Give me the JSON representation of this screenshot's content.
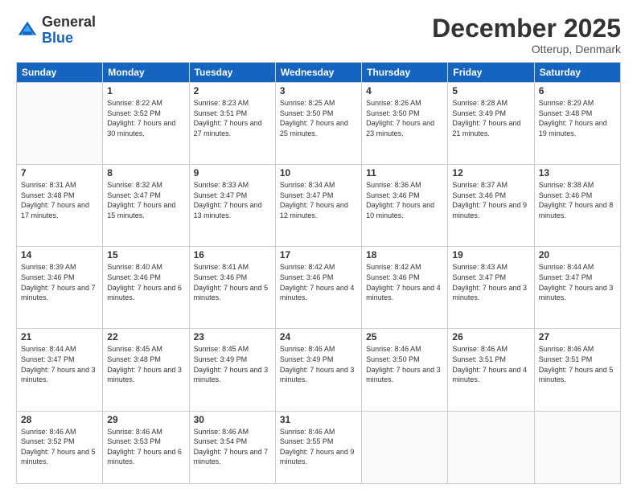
{
  "logo": {
    "general": "General",
    "blue": "Blue"
  },
  "header": {
    "month": "December 2025",
    "location": "Otterup, Denmark"
  },
  "weekdays": [
    "Sunday",
    "Monday",
    "Tuesday",
    "Wednesday",
    "Thursday",
    "Friday",
    "Saturday"
  ],
  "weeks": [
    [
      {
        "day": "",
        "sunrise": "",
        "sunset": "",
        "daylight": ""
      },
      {
        "day": "1",
        "sunrise": "Sunrise: 8:22 AM",
        "sunset": "Sunset: 3:52 PM",
        "daylight": "Daylight: 7 hours and 30 minutes."
      },
      {
        "day": "2",
        "sunrise": "Sunrise: 8:23 AM",
        "sunset": "Sunset: 3:51 PM",
        "daylight": "Daylight: 7 hours and 27 minutes."
      },
      {
        "day": "3",
        "sunrise": "Sunrise: 8:25 AM",
        "sunset": "Sunset: 3:50 PM",
        "daylight": "Daylight: 7 hours and 25 minutes."
      },
      {
        "day": "4",
        "sunrise": "Sunrise: 8:26 AM",
        "sunset": "Sunset: 3:50 PM",
        "daylight": "Daylight: 7 hours and 23 minutes."
      },
      {
        "day": "5",
        "sunrise": "Sunrise: 8:28 AM",
        "sunset": "Sunset: 3:49 PM",
        "daylight": "Daylight: 7 hours and 21 minutes."
      },
      {
        "day": "6",
        "sunrise": "Sunrise: 8:29 AM",
        "sunset": "Sunset: 3:48 PM",
        "daylight": "Daylight: 7 hours and 19 minutes."
      }
    ],
    [
      {
        "day": "7",
        "sunrise": "Sunrise: 8:31 AM",
        "sunset": "Sunset: 3:48 PM",
        "daylight": "Daylight: 7 hours and 17 minutes."
      },
      {
        "day": "8",
        "sunrise": "Sunrise: 8:32 AM",
        "sunset": "Sunset: 3:47 PM",
        "daylight": "Daylight: 7 hours and 15 minutes."
      },
      {
        "day": "9",
        "sunrise": "Sunrise: 8:33 AM",
        "sunset": "Sunset: 3:47 PM",
        "daylight": "Daylight: 7 hours and 13 minutes."
      },
      {
        "day": "10",
        "sunrise": "Sunrise: 8:34 AM",
        "sunset": "Sunset: 3:47 PM",
        "daylight": "Daylight: 7 hours and 12 minutes."
      },
      {
        "day": "11",
        "sunrise": "Sunrise: 8:36 AM",
        "sunset": "Sunset: 3:46 PM",
        "daylight": "Daylight: 7 hours and 10 minutes."
      },
      {
        "day": "12",
        "sunrise": "Sunrise: 8:37 AM",
        "sunset": "Sunset: 3:46 PM",
        "daylight": "Daylight: 7 hours and 9 minutes."
      },
      {
        "day": "13",
        "sunrise": "Sunrise: 8:38 AM",
        "sunset": "Sunset: 3:46 PM",
        "daylight": "Daylight: 7 hours and 8 minutes."
      }
    ],
    [
      {
        "day": "14",
        "sunrise": "Sunrise: 8:39 AM",
        "sunset": "Sunset: 3:46 PM",
        "daylight": "Daylight: 7 hours and 7 minutes."
      },
      {
        "day": "15",
        "sunrise": "Sunrise: 8:40 AM",
        "sunset": "Sunset: 3:46 PM",
        "daylight": "Daylight: 7 hours and 6 minutes."
      },
      {
        "day": "16",
        "sunrise": "Sunrise: 8:41 AM",
        "sunset": "Sunset: 3:46 PM",
        "daylight": "Daylight: 7 hours and 5 minutes."
      },
      {
        "day": "17",
        "sunrise": "Sunrise: 8:42 AM",
        "sunset": "Sunset: 3:46 PM",
        "daylight": "Daylight: 7 hours and 4 minutes."
      },
      {
        "day": "18",
        "sunrise": "Sunrise: 8:42 AM",
        "sunset": "Sunset: 3:46 PM",
        "daylight": "Daylight: 7 hours and 4 minutes."
      },
      {
        "day": "19",
        "sunrise": "Sunrise: 8:43 AM",
        "sunset": "Sunset: 3:47 PM",
        "daylight": "Daylight: 7 hours and 3 minutes."
      },
      {
        "day": "20",
        "sunrise": "Sunrise: 8:44 AM",
        "sunset": "Sunset: 3:47 PM",
        "daylight": "Daylight: 7 hours and 3 minutes."
      }
    ],
    [
      {
        "day": "21",
        "sunrise": "Sunrise: 8:44 AM",
        "sunset": "Sunset: 3:47 PM",
        "daylight": "Daylight: 7 hours and 3 minutes."
      },
      {
        "day": "22",
        "sunrise": "Sunrise: 8:45 AM",
        "sunset": "Sunset: 3:48 PM",
        "daylight": "Daylight: 7 hours and 3 minutes."
      },
      {
        "day": "23",
        "sunrise": "Sunrise: 8:45 AM",
        "sunset": "Sunset: 3:49 PM",
        "daylight": "Daylight: 7 hours and 3 minutes."
      },
      {
        "day": "24",
        "sunrise": "Sunrise: 8:46 AM",
        "sunset": "Sunset: 3:49 PM",
        "daylight": "Daylight: 7 hours and 3 minutes."
      },
      {
        "day": "25",
        "sunrise": "Sunrise: 8:46 AM",
        "sunset": "Sunset: 3:50 PM",
        "daylight": "Daylight: 7 hours and 3 minutes."
      },
      {
        "day": "26",
        "sunrise": "Sunrise: 8:46 AM",
        "sunset": "Sunset: 3:51 PM",
        "daylight": "Daylight: 7 hours and 4 minutes."
      },
      {
        "day": "27",
        "sunrise": "Sunrise: 8:46 AM",
        "sunset": "Sunset: 3:51 PM",
        "daylight": "Daylight: 7 hours and 5 minutes."
      }
    ],
    [
      {
        "day": "28",
        "sunrise": "Sunrise: 8:46 AM",
        "sunset": "Sunset: 3:52 PM",
        "daylight": "Daylight: 7 hours and 5 minutes."
      },
      {
        "day": "29",
        "sunrise": "Sunrise: 8:46 AM",
        "sunset": "Sunset: 3:53 PM",
        "daylight": "Daylight: 7 hours and 6 minutes."
      },
      {
        "day": "30",
        "sunrise": "Sunrise: 8:46 AM",
        "sunset": "Sunset: 3:54 PM",
        "daylight": "Daylight: 7 hours and 7 minutes."
      },
      {
        "day": "31",
        "sunrise": "Sunrise: 8:46 AM",
        "sunset": "Sunset: 3:55 PM",
        "daylight": "Daylight: 7 hours and 9 minutes."
      },
      {
        "day": "",
        "sunrise": "",
        "sunset": "",
        "daylight": ""
      },
      {
        "day": "",
        "sunrise": "",
        "sunset": "",
        "daylight": ""
      },
      {
        "day": "",
        "sunrise": "",
        "sunset": "",
        "daylight": ""
      }
    ]
  ]
}
